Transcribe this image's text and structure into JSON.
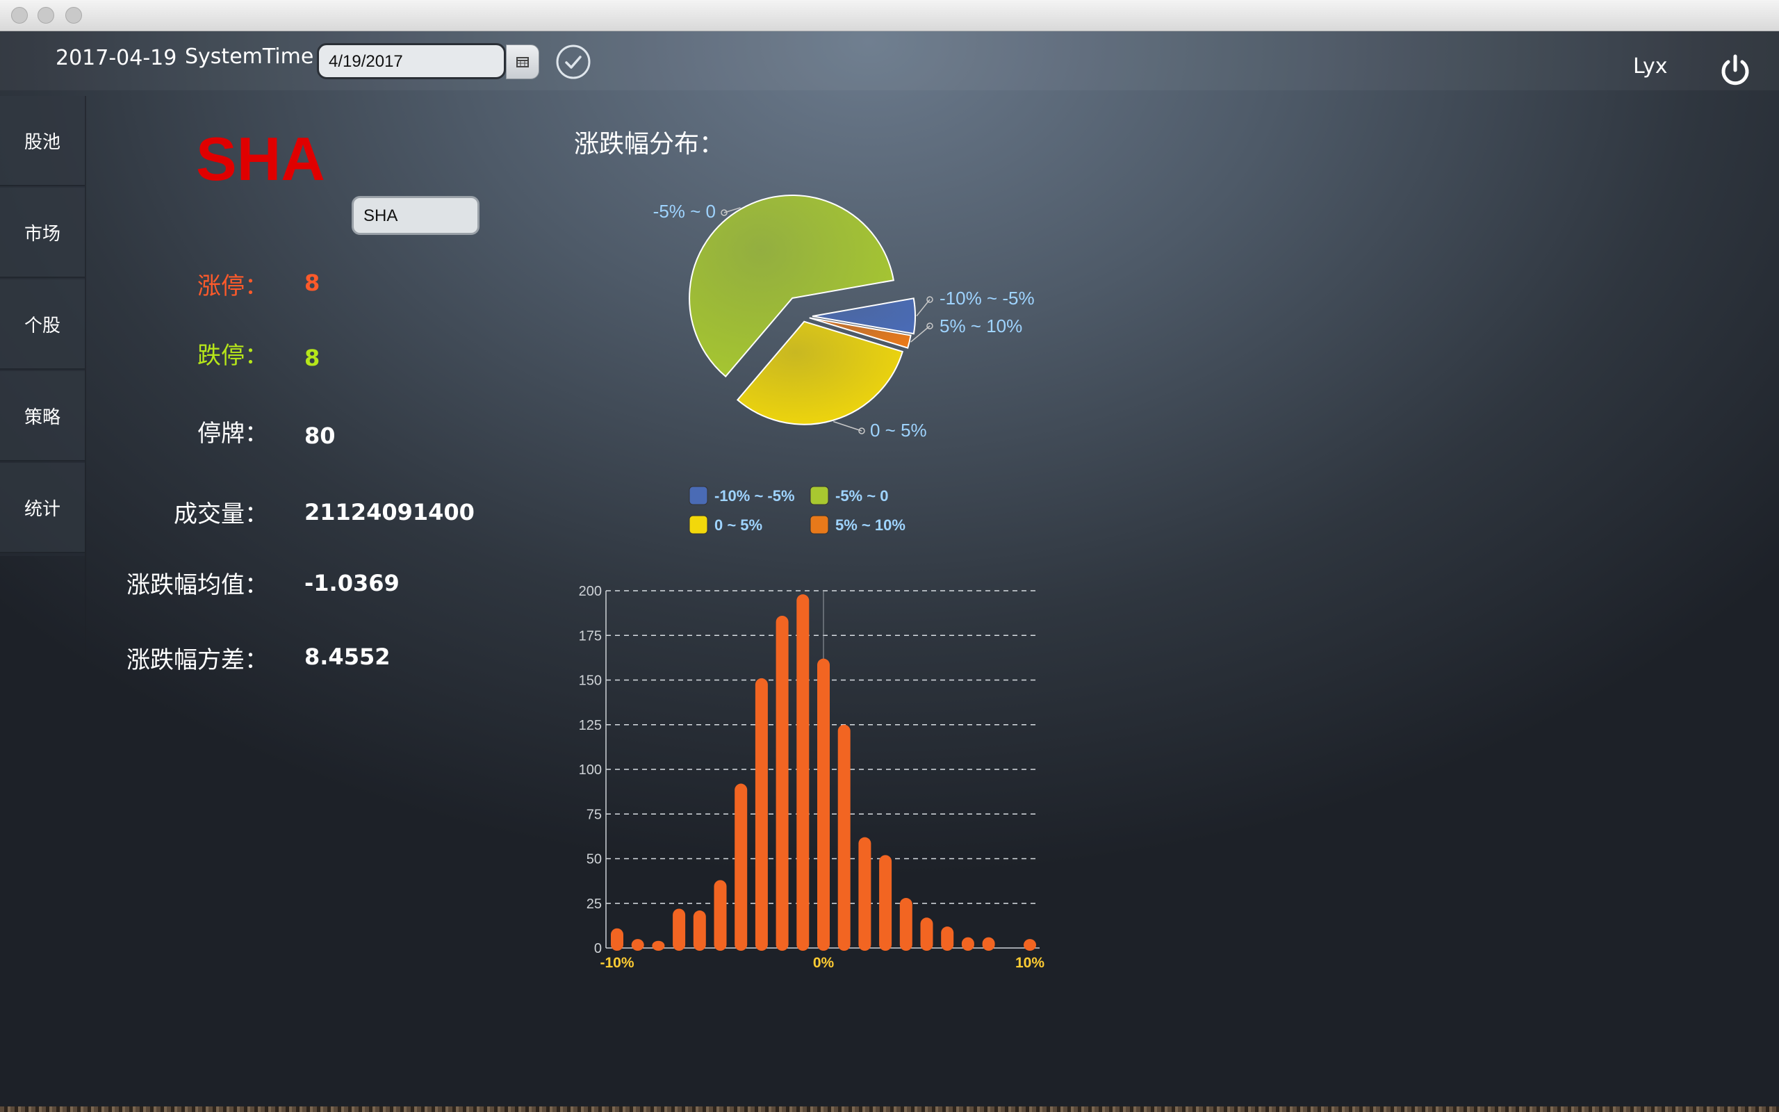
{
  "window": {
    "title_controls": [
      "close",
      "minimize",
      "zoom"
    ]
  },
  "topbar": {
    "date": "2017-04-19",
    "system_time_label": "SystemTime",
    "date_input_value": "4/19/2017",
    "calendar_icon": "calendar-icon",
    "confirm_icon": "check-circle-icon",
    "user": "Lyx",
    "power_icon": "power-icon"
  },
  "sidebar": {
    "items": [
      {
        "label": "股池"
      },
      {
        "label": "市场"
      },
      {
        "label": "个股"
      },
      {
        "label": "策略"
      },
      {
        "label": "统计"
      }
    ]
  },
  "market": {
    "code": "SHA",
    "select_value": "SHA",
    "stats": [
      {
        "label": "涨停：",
        "value": "8",
        "color": "#ff5a2a"
      },
      {
        "label": "跌停：",
        "value": "8",
        "color": "#b6e61a"
      },
      {
        "label": "停牌：",
        "value": "80",
        "color": "#ffffff"
      },
      {
        "label": "成交量：",
        "value": "21124091400",
        "color": "#ffffff"
      },
      {
        "label": "涨跌幅均值：",
        "value": "-1.0369",
        "color": "#ffffff"
      },
      {
        "label": "涨跌幅方差：",
        "value": "8.4552",
        "color": "#ffffff"
      }
    ]
  },
  "chart_data": [
    {
      "type": "pie",
      "title": "涨跌幅分布：",
      "slices": [
        {
          "label": "-10% ~ -5%",
          "value": 5.5,
          "color": "#4a6bb5"
        },
        {
          "label": "5% ~ 10%",
          "value": 2.0,
          "color": "#e8791a"
        },
        {
          "label": "0 ~ 5%",
          "value": 31.5,
          "color": "#f2d80b"
        },
        {
          "label": "-5% ~ 0",
          "value": 61.0,
          "color": "#a8c830"
        }
      ],
      "legend_placement": "bottom"
    },
    {
      "type": "bar",
      "categories": [
        "-10%",
        "",
        "",
        "",
        "",
        "",
        "",
        "",
        "",
        "",
        "0%",
        "",
        "",
        "",
        "",
        "",
        "",
        "",
        "",
        "",
        "10%"
      ],
      "x_tick_labels": [
        "-10%",
        "0%",
        "10%"
      ],
      "values": [
        11,
        5,
        4,
        22,
        21,
        38,
        92,
        151,
        186,
        198,
        162,
        125,
        62,
        52,
        28,
        17,
        12,
        6,
        6,
        0,
        5
      ],
      "ylim": [
        0,
        200
      ],
      "yticks": [
        0,
        25,
        50,
        75,
        100,
        125,
        150,
        175,
        200
      ],
      "bar_color": "#f26522",
      "grid": true
    }
  ]
}
